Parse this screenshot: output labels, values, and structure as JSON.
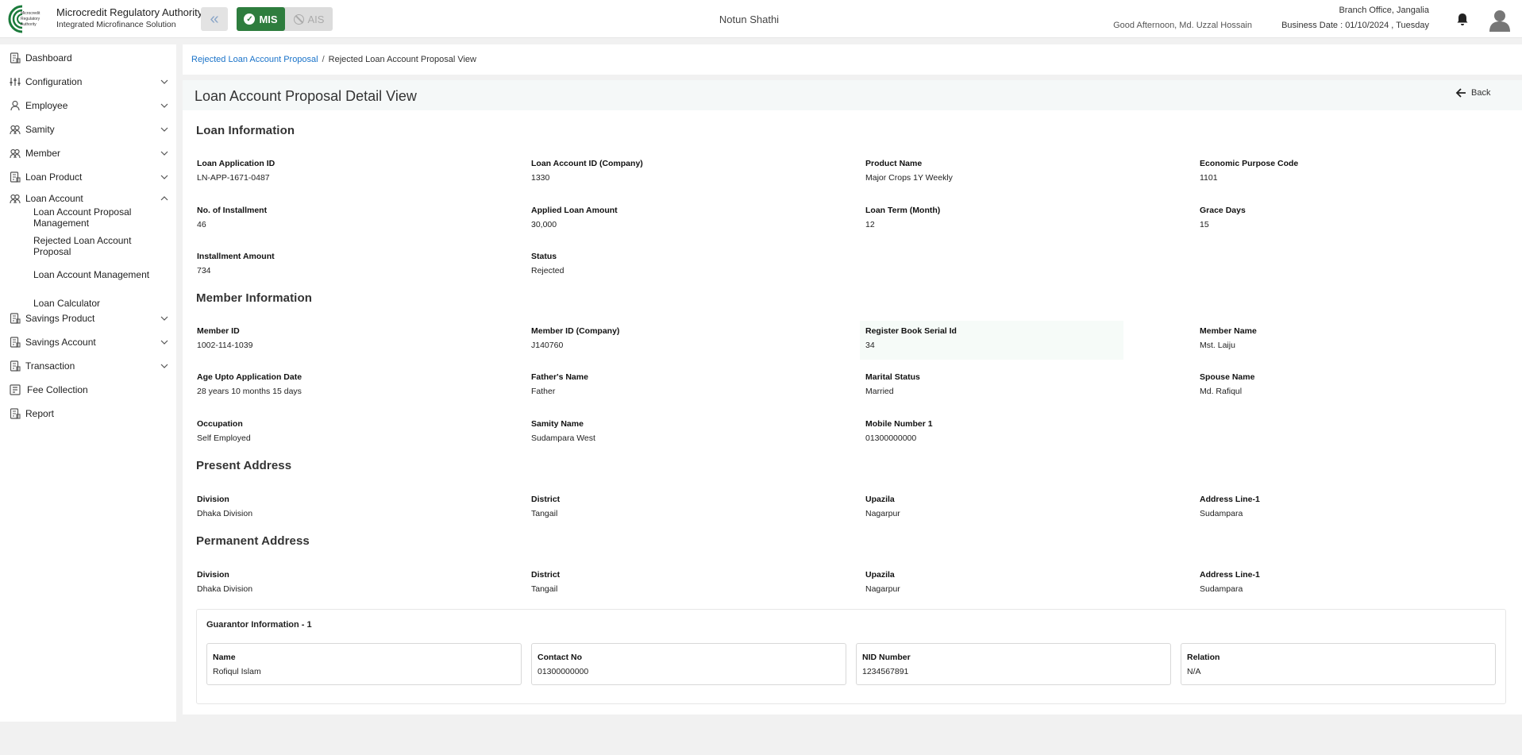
{
  "header": {
    "brand_title": "Microcredit Regulatory Authority",
    "brand_subtitle": "Integrated Microfinance Solution",
    "logo_text": "Microcredit Regulatory Authority",
    "mode_mis": "MIS",
    "mode_ais": "AIS",
    "org_name": "Notun Shathi",
    "greeting": "Good Afternoon, Md. Uzzal Hossain",
    "branch": "Branch Office, Jangalia",
    "business_date": "Business Date : 01/10/2024 , Tuesday"
  },
  "sidebar": {
    "items": [
      {
        "label": "Dashboard"
      },
      {
        "label": "Configuration"
      },
      {
        "label": "Employee"
      },
      {
        "label": "Samity"
      },
      {
        "label": "Member"
      },
      {
        "label": "Loan Product"
      },
      {
        "label": "Loan Account"
      },
      {
        "label": "Savings Product"
      },
      {
        "label": "Savings Account"
      },
      {
        "label": "Transaction"
      },
      {
        "label": "Fee Collection"
      },
      {
        "label": "Report"
      }
    ],
    "loan_account_sub": [
      {
        "label": "Loan Account Proposal Management"
      },
      {
        "label": "Rejected Loan Account Proposal"
      },
      {
        "label": "Loan Account Management"
      },
      {
        "label": "Loan Calculator"
      }
    ]
  },
  "breadcrumb": {
    "link": "Rejected Loan Account Proposal",
    "separator": "/",
    "current": "Rejected Loan Account Proposal View"
  },
  "page": {
    "title": "Loan Account Proposal Detail View",
    "back_label": "Back"
  },
  "loan_info": {
    "title": "Loan Information",
    "fields": [
      {
        "label": "Loan Application ID",
        "value": "LN-APP-1671-0487"
      },
      {
        "label": "Loan Account ID (Company)",
        "value": "1330"
      },
      {
        "label": "Product Name",
        "value": "Major Crops 1Y Weekly"
      },
      {
        "label": "Economic Purpose Code",
        "value": "1101"
      },
      {
        "label": "No. of Installment",
        "value": "46"
      },
      {
        "label": "Applied Loan Amount",
        "value": "30,000"
      },
      {
        "label": "Loan Term (Month)",
        "value": "12"
      },
      {
        "label": "Grace Days",
        "value": "15"
      },
      {
        "label": "Installment Amount",
        "value": "734"
      },
      {
        "label": "Status",
        "value": "Rejected"
      }
    ]
  },
  "member_info": {
    "title": "Member Information",
    "fields": [
      {
        "label": "Member ID",
        "value": "1002-114-1039"
      },
      {
        "label": "Member ID (Company)",
        "value": "J140760"
      },
      {
        "label": "Register Book Serial Id",
        "value": "34"
      },
      {
        "label": "Member Name",
        "value": "Mst. Laiju"
      },
      {
        "label": "Age Upto Application Date",
        "value": "28 years 10 months 15 days"
      },
      {
        "label": "Father's Name",
        "value": "Father"
      },
      {
        "label": "Marital Status",
        "value": "Married"
      },
      {
        "label": "Spouse Name",
        "value": "Md. Rafiqul"
      },
      {
        "label": "Occupation",
        "value": "Self Employed"
      },
      {
        "label": "Samity Name",
        "value": "Sudampara West"
      },
      {
        "label": "Mobile Number 1",
        "value": "01300000000"
      }
    ]
  },
  "present_address": {
    "title": "Present Address",
    "fields": [
      {
        "label": "Division",
        "value": "Dhaka Division"
      },
      {
        "label": "District",
        "value": "Tangail"
      },
      {
        "label": "Upazila",
        "value": "Nagarpur"
      },
      {
        "label": "Address Line-1",
        "value": "Sudampara"
      }
    ]
  },
  "permanent_address": {
    "title": "Permanent Address",
    "fields": [
      {
        "label": "Division",
        "value": "Dhaka Division"
      },
      {
        "label": "District",
        "value": "Tangail"
      },
      {
        "label": "Upazila",
        "value": "Nagarpur"
      },
      {
        "label": "Address Line-1",
        "value": "Sudampara"
      }
    ]
  },
  "guarantor": {
    "title": "Guarantor Information - 1",
    "fields": [
      {
        "label": "Name",
        "value": "Rofiqul Islam"
      },
      {
        "label": "Contact No",
        "value": "01300000000"
      },
      {
        "label": "NID Number",
        "value": "1234567891"
      },
      {
        "label": "Relation",
        "value": "N/A"
      }
    ]
  },
  "colors": {
    "mis_active": "#2e7d3e",
    "link": "#1a73c9",
    "title_bar": "#f5f8f8"
  }
}
